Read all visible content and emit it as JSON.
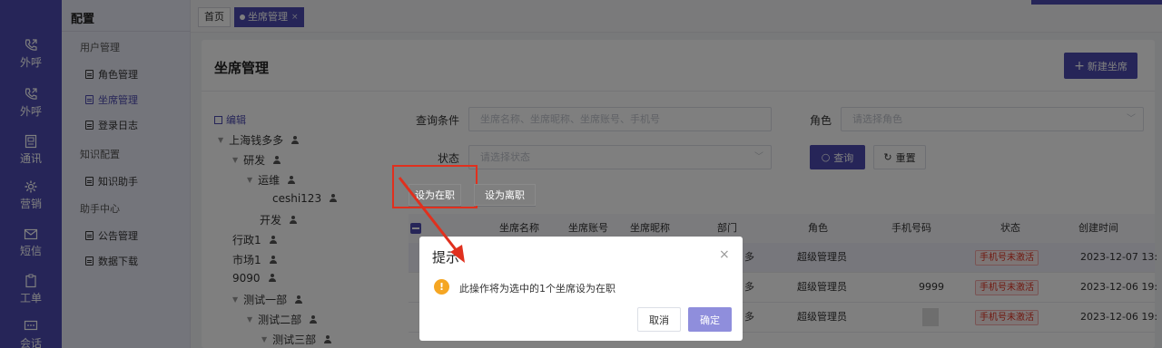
{
  "rail": {
    "items": [
      {
        "label": "外呼",
        "icon": "phone-out-icon"
      },
      {
        "label": "外呼",
        "icon": "phone-out-icon"
      },
      {
        "label": "通讯",
        "icon": "address-book-icon"
      },
      {
        "label": "营销",
        "icon": "gear-icon"
      },
      {
        "label": "短信",
        "icon": "message-icon"
      },
      {
        "label": "工单",
        "icon": "clipboard-icon"
      },
      {
        "label": "会话",
        "icon": "chat-icon"
      }
    ]
  },
  "submenu": {
    "title": "配置",
    "groups": [
      {
        "label": "用户管理",
        "items": [
          {
            "label": "角色管理"
          },
          {
            "label": "坐席管理"
          },
          {
            "label": "登录日志"
          }
        ]
      },
      {
        "label": "知识配置",
        "items": [
          {
            "label": "知识助手"
          }
        ]
      },
      {
        "label": "助手中心",
        "items": [
          {
            "label": "公告管理"
          },
          {
            "label": "数据下载"
          }
        ]
      }
    ]
  },
  "tabs": {
    "home": "首页",
    "active": "坐席管理",
    "close": "×"
  },
  "page": {
    "title": "坐席管理",
    "new_button": "新建坐席"
  },
  "tree": {
    "edit_label": "编辑",
    "nodes": [
      {
        "label": "上海钱多多",
        "caret": "▼"
      },
      {
        "label": "研发",
        "caret": "▼"
      },
      {
        "label": "运维",
        "caret": "▼"
      },
      {
        "label": "ceshi123",
        "caret": ""
      },
      {
        "label": "开发",
        "caret": ""
      },
      {
        "label": "行政1",
        "caret": ""
      },
      {
        "label": "市场1",
        "caret": ""
      },
      {
        "label": "9090",
        "caret": ""
      },
      {
        "label": "测试一部",
        "caret": "▼"
      },
      {
        "label": "测试二部",
        "caret": "▼"
      },
      {
        "label": "测试三部",
        "caret": "▼"
      }
    ]
  },
  "filters": {
    "query_label": "查询条件",
    "query_placeholder": "坐席名称、坐席昵称、坐席账号、手机号",
    "role_label": "角色",
    "role_placeholder": "请选择角色",
    "status_label": "状态",
    "status_placeholder": "请选择状态",
    "query_button": "查询",
    "reset_button": "重置"
  },
  "actions": {
    "set_active": "设为在职",
    "set_leave": "设为离职"
  },
  "table": {
    "columns": [
      "坐席名称",
      "坐席账号",
      "坐席昵称",
      "部门",
      "角色",
      "手机号码",
      "状态",
      "创建时间"
    ],
    "rows": [
      {
        "dept": "多",
        "role": "超级管理员",
        "phone": "",
        "status": "手机号未激活",
        "created": "2023-12-07 13:"
      },
      {
        "dept": "多",
        "role": "超级管理员",
        "phone": "9999",
        "status": "手机号未激活",
        "created": "2023-12-06 19:"
      },
      {
        "dept": "多",
        "role": "超级管理员",
        "phone": "",
        "status": "手机号未激活",
        "created": "2023-12-06 19:"
      }
    ]
  },
  "dialog": {
    "title": "提示",
    "message": "此操作将为选中的1个坐席设为在职",
    "warn_glyph": "!",
    "cancel": "取消",
    "confirm": "确定",
    "close": "×"
  },
  "colors": {
    "brand": "#4c4bb0",
    "danger": "#e0301e",
    "warning": "#f5a623"
  }
}
